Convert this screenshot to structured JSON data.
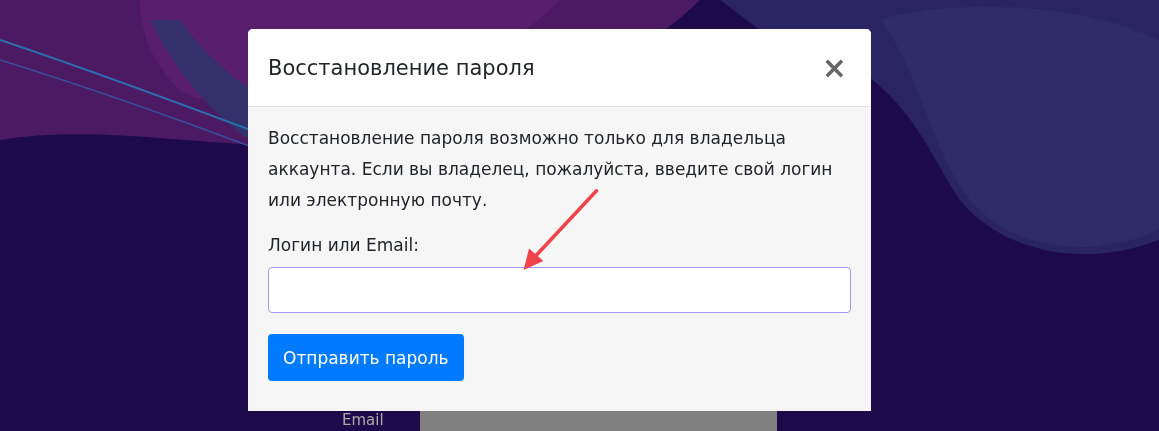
{
  "background_form": {
    "label": "Email"
  },
  "modal": {
    "title": "Восстановление пароля",
    "close": "×",
    "message": "Восстановление пароля возможно только для владельца аккаунта. Если вы владелец, пожалуйста, введите свой логин или электронную почту.",
    "field": {
      "label": "Логин или Email:",
      "focused": true
    },
    "button": "Отправить пароль"
  }
}
